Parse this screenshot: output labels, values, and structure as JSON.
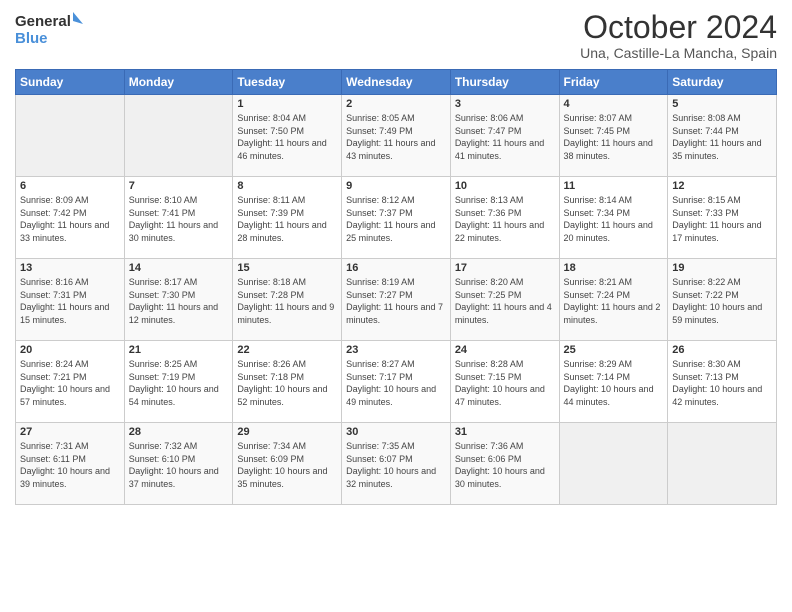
{
  "logo": {
    "line1": "General",
    "line2": "Blue"
  },
  "header": {
    "month": "October 2024",
    "location": "Una, Castille-La Mancha, Spain"
  },
  "days_of_week": [
    "Sunday",
    "Monday",
    "Tuesday",
    "Wednesday",
    "Thursday",
    "Friday",
    "Saturday"
  ],
  "weeks": [
    [
      {
        "day": "",
        "info": ""
      },
      {
        "day": "",
        "info": ""
      },
      {
        "day": "1",
        "info": "Sunrise: 8:04 AM\nSunset: 7:50 PM\nDaylight: 11 hours and 46 minutes."
      },
      {
        "day": "2",
        "info": "Sunrise: 8:05 AM\nSunset: 7:49 PM\nDaylight: 11 hours and 43 minutes."
      },
      {
        "day": "3",
        "info": "Sunrise: 8:06 AM\nSunset: 7:47 PM\nDaylight: 11 hours and 41 minutes."
      },
      {
        "day": "4",
        "info": "Sunrise: 8:07 AM\nSunset: 7:45 PM\nDaylight: 11 hours and 38 minutes."
      },
      {
        "day": "5",
        "info": "Sunrise: 8:08 AM\nSunset: 7:44 PM\nDaylight: 11 hours and 35 minutes."
      }
    ],
    [
      {
        "day": "6",
        "info": "Sunrise: 8:09 AM\nSunset: 7:42 PM\nDaylight: 11 hours and 33 minutes."
      },
      {
        "day": "7",
        "info": "Sunrise: 8:10 AM\nSunset: 7:41 PM\nDaylight: 11 hours and 30 minutes."
      },
      {
        "day": "8",
        "info": "Sunrise: 8:11 AM\nSunset: 7:39 PM\nDaylight: 11 hours and 28 minutes."
      },
      {
        "day": "9",
        "info": "Sunrise: 8:12 AM\nSunset: 7:37 PM\nDaylight: 11 hours and 25 minutes."
      },
      {
        "day": "10",
        "info": "Sunrise: 8:13 AM\nSunset: 7:36 PM\nDaylight: 11 hours and 22 minutes."
      },
      {
        "day": "11",
        "info": "Sunrise: 8:14 AM\nSunset: 7:34 PM\nDaylight: 11 hours and 20 minutes."
      },
      {
        "day": "12",
        "info": "Sunrise: 8:15 AM\nSunset: 7:33 PM\nDaylight: 11 hours and 17 minutes."
      }
    ],
    [
      {
        "day": "13",
        "info": "Sunrise: 8:16 AM\nSunset: 7:31 PM\nDaylight: 11 hours and 15 minutes."
      },
      {
        "day": "14",
        "info": "Sunrise: 8:17 AM\nSunset: 7:30 PM\nDaylight: 11 hours and 12 minutes."
      },
      {
        "day": "15",
        "info": "Sunrise: 8:18 AM\nSunset: 7:28 PM\nDaylight: 11 hours and 9 minutes."
      },
      {
        "day": "16",
        "info": "Sunrise: 8:19 AM\nSunset: 7:27 PM\nDaylight: 11 hours and 7 minutes."
      },
      {
        "day": "17",
        "info": "Sunrise: 8:20 AM\nSunset: 7:25 PM\nDaylight: 11 hours and 4 minutes."
      },
      {
        "day": "18",
        "info": "Sunrise: 8:21 AM\nSunset: 7:24 PM\nDaylight: 11 hours and 2 minutes."
      },
      {
        "day": "19",
        "info": "Sunrise: 8:22 AM\nSunset: 7:22 PM\nDaylight: 10 hours and 59 minutes."
      }
    ],
    [
      {
        "day": "20",
        "info": "Sunrise: 8:24 AM\nSunset: 7:21 PM\nDaylight: 10 hours and 57 minutes."
      },
      {
        "day": "21",
        "info": "Sunrise: 8:25 AM\nSunset: 7:19 PM\nDaylight: 10 hours and 54 minutes."
      },
      {
        "day": "22",
        "info": "Sunrise: 8:26 AM\nSunset: 7:18 PM\nDaylight: 10 hours and 52 minutes."
      },
      {
        "day": "23",
        "info": "Sunrise: 8:27 AM\nSunset: 7:17 PM\nDaylight: 10 hours and 49 minutes."
      },
      {
        "day": "24",
        "info": "Sunrise: 8:28 AM\nSunset: 7:15 PM\nDaylight: 10 hours and 47 minutes."
      },
      {
        "day": "25",
        "info": "Sunrise: 8:29 AM\nSunset: 7:14 PM\nDaylight: 10 hours and 44 minutes."
      },
      {
        "day": "26",
        "info": "Sunrise: 8:30 AM\nSunset: 7:13 PM\nDaylight: 10 hours and 42 minutes."
      }
    ],
    [
      {
        "day": "27",
        "info": "Sunrise: 7:31 AM\nSunset: 6:11 PM\nDaylight: 10 hours and 39 minutes."
      },
      {
        "day": "28",
        "info": "Sunrise: 7:32 AM\nSunset: 6:10 PM\nDaylight: 10 hours and 37 minutes."
      },
      {
        "day": "29",
        "info": "Sunrise: 7:34 AM\nSunset: 6:09 PM\nDaylight: 10 hours and 35 minutes."
      },
      {
        "day": "30",
        "info": "Sunrise: 7:35 AM\nSunset: 6:07 PM\nDaylight: 10 hours and 32 minutes."
      },
      {
        "day": "31",
        "info": "Sunrise: 7:36 AM\nSunset: 6:06 PM\nDaylight: 10 hours and 30 minutes."
      },
      {
        "day": "",
        "info": ""
      },
      {
        "day": "",
        "info": ""
      }
    ]
  ]
}
